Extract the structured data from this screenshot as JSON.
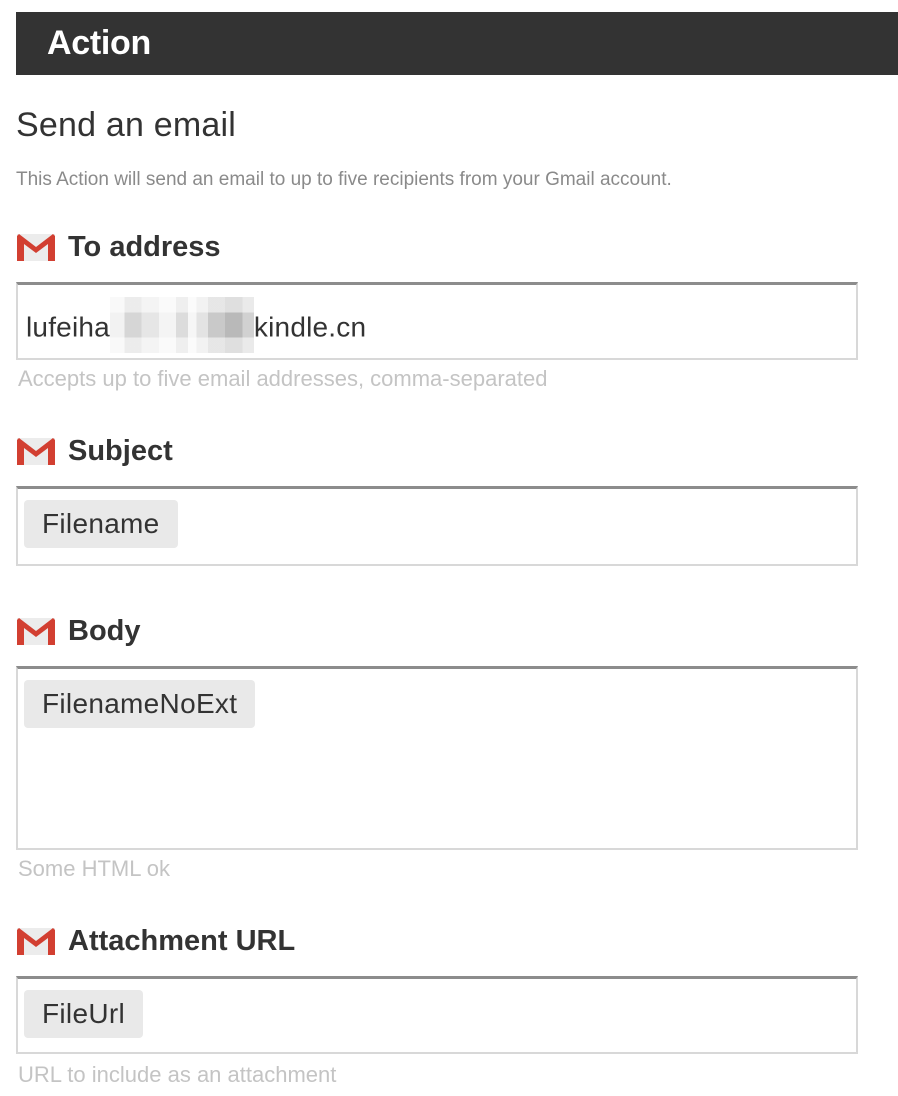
{
  "header": {
    "title": "Action"
  },
  "action": {
    "title": "Send an email",
    "description": "This Action will send an email to up to five recipients from your Gmail account."
  },
  "service_icon": "gmail-icon",
  "fields": {
    "to_address": {
      "label": "To address",
      "value_start": "lufeiha",
      "value_end": "kindle.cn",
      "help": "Accepts up to five email addresses, comma-separated"
    },
    "subject": {
      "label": "Subject",
      "ingredient": "Filename"
    },
    "body": {
      "label": "Body",
      "ingredient": "FilenameNoExt",
      "help": "Some HTML ok"
    },
    "attachment_url": {
      "label": "Attachment URL",
      "ingredient": "FileUrl",
      "help": "URL to include as an attachment"
    }
  },
  "colors": {
    "header_bg": "#333333",
    "gmail_red": "#d23f31",
    "pill_bg": "#e9e9e9",
    "help_text": "#c4c4c4"
  }
}
